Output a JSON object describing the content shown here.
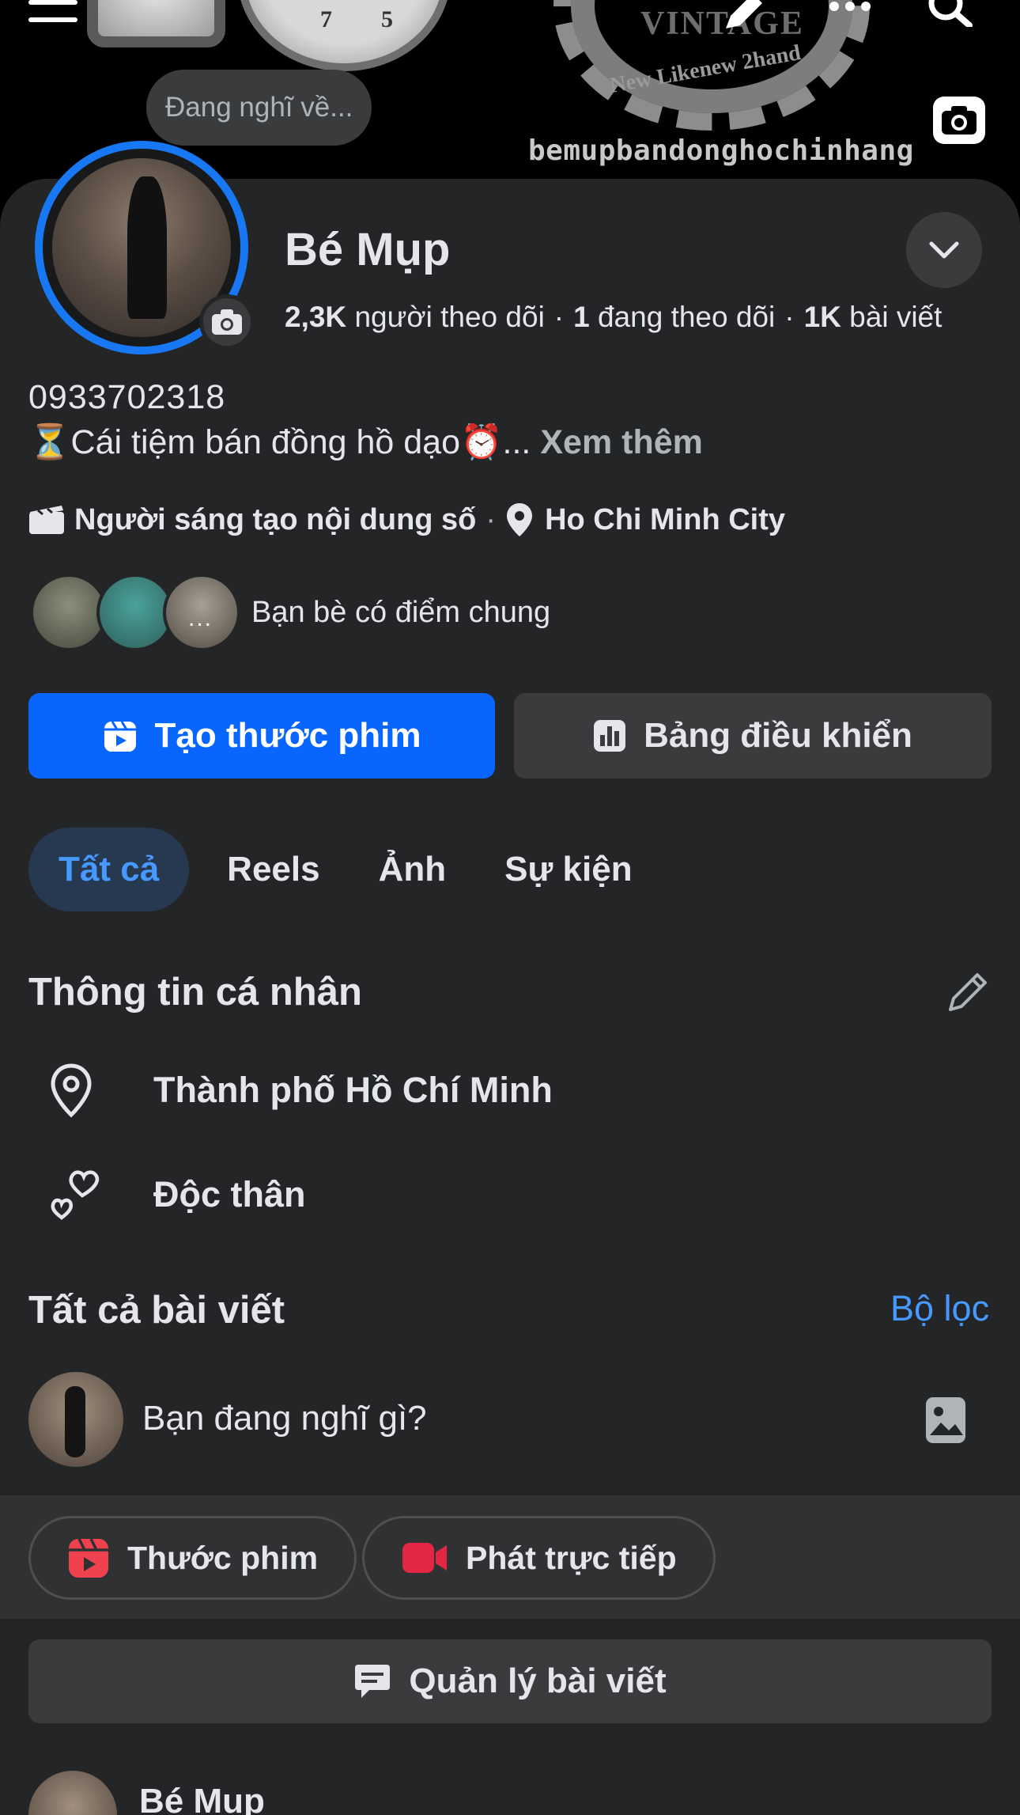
{
  "cover": {
    "logo_title": "VINTAGE",
    "logo_subtitle": "New Likenew 2hand",
    "handle": "bemupbandonghochinhang",
    "watch_numbers": [
      "7",
      "5"
    ]
  },
  "status_bubble": "Đang nghĩ về...",
  "profile": {
    "name": "Bé Mụp",
    "followers_count": "2,3K",
    "followers_label": "người theo dõi",
    "following_count": "1",
    "following_label": "đang theo dõi",
    "posts_count": "1K",
    "posts_label": "bài viết",
    "separator": "·",
    "phone": "0933702318",
    "bio": "⏳Cái tiệm bán đồng hồ dạo⏰...",
    "see_more": "Xem thêm",
    "category": "Người sáng tạo nội dung số",
    "meta_separator": "·",
    "location": "Ho Chi Minh City",
    "mutual_friends_label": "Bạn bè có điểm chung",
    "mutual_more": "..."
  },
  "actions": {
    "primary": "Tạo thước phim",
    "secondary": "Bảng điều khiển"
  },
  "tabs": [
    {
      "label": "Tất cả",
      "active": true
    },
    {
      "label": "Reels",
      "active": false
    },
    {
      "label": "Ảnh",
      "active": false
    },
    {
      "label": "Sự kiện",
      "active": false
    }
  ],
  "personal_info": {
    "title": "Thông tin cá nhân",
    "items": [
      {
        "icon": "location-pin-icon",
        "text": "Thành phố Hồ Chí Minh"
      },
      {
        "icon": "hearts-icon",
        "text": "Độc thân"
      }
    ]
  },
  "posts": {
    "title": "Tất cả bài viết",
    "filter": "Bộ lọc",
    "composer_placeholder": "Bạn đang nghĩ gì?",
    "reel_button": "Thước phim",
    "live_button": "Phát trực tiếp",
    "manage_button": "Quản lý bài viết",
    "first_post_author": "Bé Mụp"
  },
  "colors": {
    "background": "#242526",
    "accent": "#0866ff",
    "link": "#4599ff",
    "reels_icon": "#f0424e",
    "live_icon": "#e42645"
  }
}
